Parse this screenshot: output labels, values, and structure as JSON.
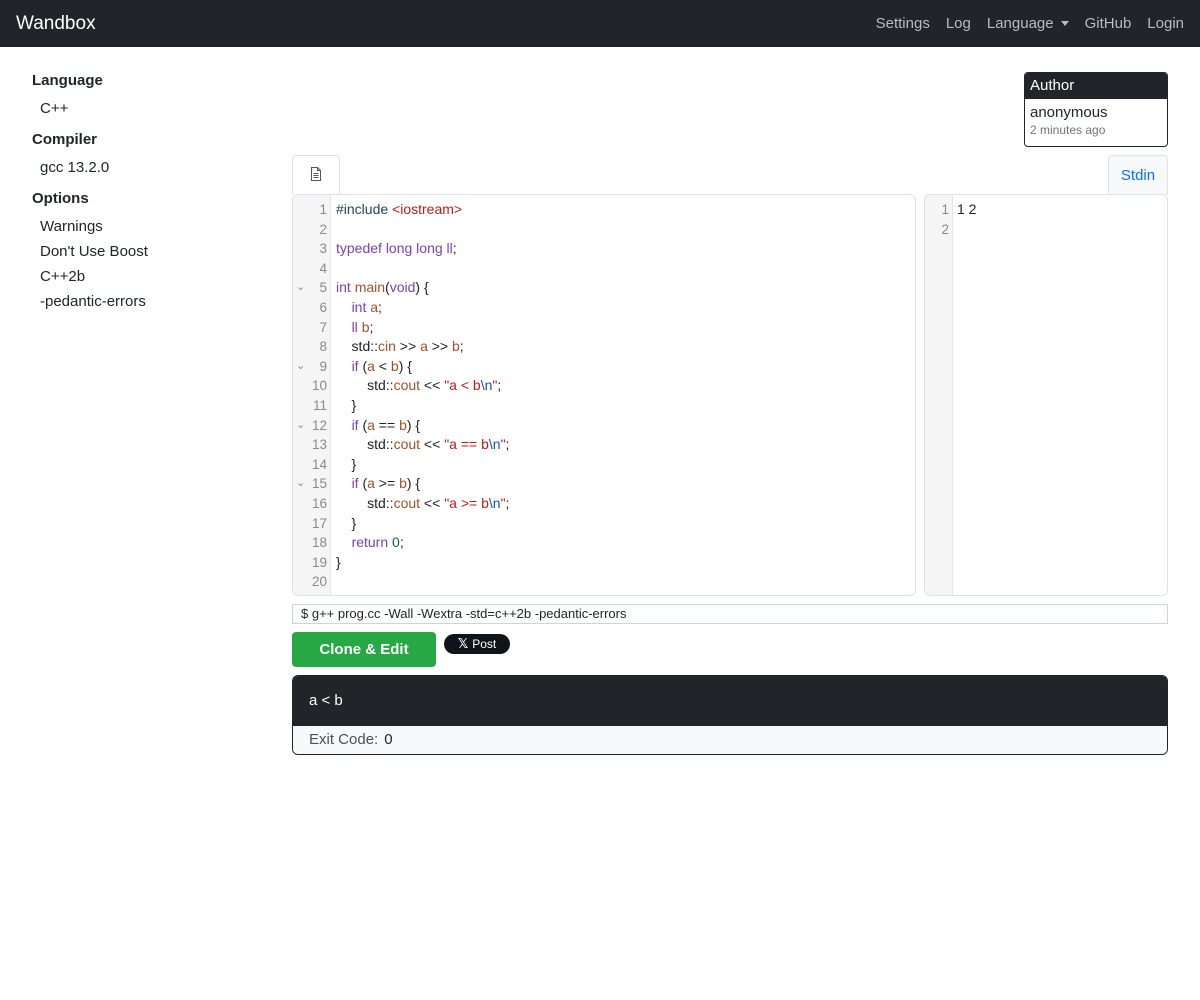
{
  "navbar": {
    "brand": "Wandbox",
    "links": [
      "Settings",
      "Log",
      "Language",
      "GitHub",
      "Login"
    ]
  },
  "sidebar": {
    "language_heading": "Language",
    "language_value": "C++",
    "compiler_heading": "Compiler",
    "compiler_value": "gcc 13.2.0",
    "options_heading": "Options",
    "options": [
      "Warnings",
      "Don't Use Boost",
      "C++2b",
      "-pedantic-errors"
    ]
  },
  "author": {
    "heading": "Author",
    "name": "anonymous",
    "time": "2 minutes ago"
  },
  "tabs": {
    "file_icon": "file-icon",
    "stdin_label": "Stdin"
  },
  "code": {
    "line_numbers": [
      "1",
      "2",
      "3",
      "4",
      "5",
      "6",
      "7",
      "8",
      "9",
      "10",
      "11",
      "12",
      "13",
      "14",
      "15",
      "16",
      "17",
      "18",
      "19",
      "20"
    ],
    "fold_lines": [
      5,
      9,
      12,
      15
    ]
  },
  "stdin": {
    "line_numbers": [
      "1",
      "2"
    ],
    "lines": [
      "1 2",
      ""
    ]
  },
  "command": "$ g++ prog.cc -Wall -Wextra -std=c++2b -pedantic-errors",
  "actions": {
    "clone_label": "Clone & Edit",
    "post_label": "Post"
  },
  "output": {
    "stdout": "a < b",
    "exit_label": "Exit Code:",
    "exit_value": "0"
  },
  "colors": {
    "navbar_bg": "#212529",
    "clone_button": "#28a745",
    "stdin_tab_text": "#0d6efd"
  }
}
